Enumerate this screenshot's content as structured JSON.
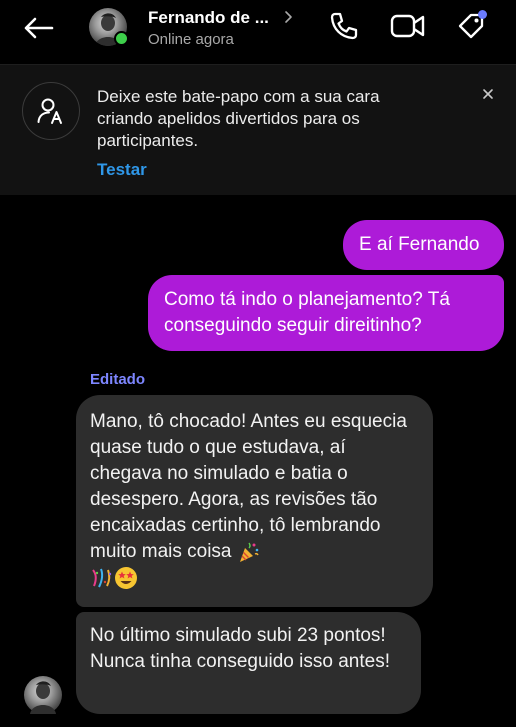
{
  "header": {
    "contact_name": "Fernando de ...",
    "status": "Online agora",
    "icons": {
      "back": "arrow-left-icon",
      "call": "phone-icon",
      "video": "video-camera-icon",
      "tag": "tag-icon"
    },
    "online_color": "#3ecf4b",
    "notification_color": "#6b7cff"
  },
  "banner": {
    "text": "Deixe este bate-papo com a sua cara criando apelidos divertidos para os participantes.",
    "action_label": "Testar",
    "icon": "person-nickname-icon",
    "close_icon": "close-icon",
    "action_color": "#2f97e8"
  },
  "messages": [
    {
      "direction": "outgoing",
      "text": "E aí Fernando"
    },
    {
      "direction": "outgoing",
      "text": "Como tá indo o planejamento? Tá conseguindo seguir direitinho?"
    },
    {
      "direction": "incoming",
      "edited_label": "Editado",
      "text": "Mano, tô chocado! Antes eu esquecia quase tudo o que estudava, aí chegava no simulado e batia o desespero. Agora, as revisões tão encaixadas certinho, tô lembrando muito mais coisa",
      "emojis": [
        "party-popper-emoji",
        "confetti-emoji",
        "star-struck-emoji"
      ]
    },
    {
      "direction": "incoming",
      "text": "No último simulado subi 23 pontos! Nunca tinha conseguido isso antes!"
    }
  ],
  "colors": {
    "outgoing_bubble": "#ad1bd8",
    "incoming_bubble": "#2d2d2d",
    "edited_label": "#7d86ff"
  }
}
